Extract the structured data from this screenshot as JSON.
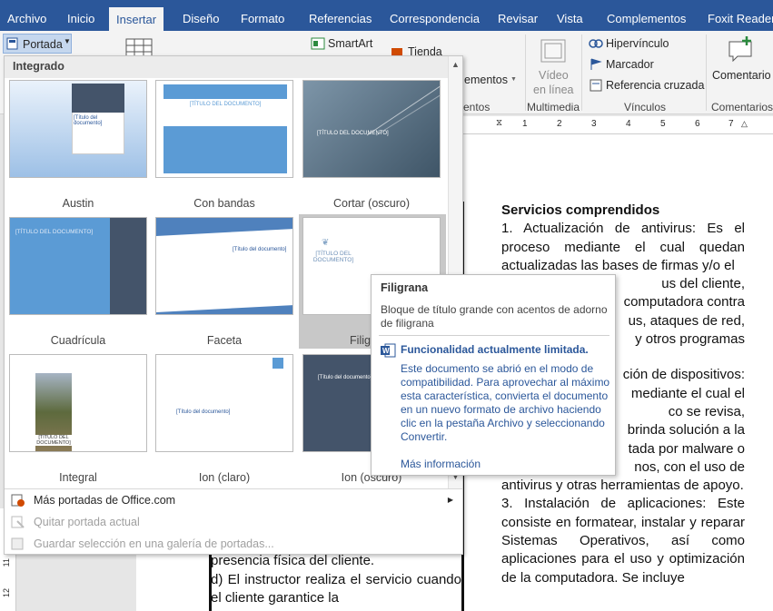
{
  "ribbon_tabs": [
    {
      "label": "Archivo"
    },
    {
      "label": "Inicio"
    },
    {
      "label": "Insertar"
    },
    {
      "label": "Diseño"
    },
    {
      "label": "Formato"
    },
    {
      "label": "Referencias"
    },
    {
      "label": "Correspondencia"
    },
    {
      "label": "Revisar"
    },
    {
      "label": "Vista"
    },
    {
      "label": "Complementos"
    },
    {
      "label": "Foxit Reader P"
    }
  ],
  "ribbon": {
    "portada_label": "Portada",
    "smartart_label": "SmartArt",
    "tienda_label": "Tienda",
    "elementos_label": "ementos",
    "elementos_group": "entos",
    "video_line1": "Vídeo",
    "video_line2": "en línea",
    "multimedia_group": "Multimedia",
    "hipervinculo_label": "Hipervínculo",
    "marcador_label": "Marcador",
    "referencia_label": "Referencia cruzada",
    "vinculos_group": "Vínculos",
    "comentario_label": "Comentario",
    "comentarios_group": "Comentarios"
  },
  "ruler": {
    "ticks": [
      "1",
      "2",
      "3",
      "4",
      "5",
      "6",
      "7"
    ],
    "vertical_ticks": [
      "12",
      "11"
    ]
  },
  "gallery": {
    "header": "Integrado",
    "tiles": [
      {
        "label": "Austin",
        "thumb_title": "[Título del documento]"
      },
      {
        "label": "Con bandas",
        "thumb_title": "[TÍTULO DEL DOCUMENTO]"
      },
      {
        "label": "Cortar (oscuro)",
        "thumb_title": "[TÍTULO DEL DOCUMENTO]"
      },
      {
        "label": "Cuadrícula",
        "thumb_title": "[TÍTULO DEL DOCUMENTO]"
      },
      {
        "label": "Faceta",
        "thumb_title": "[Título del documento]"
      },
      {
        "label": "Filigrana",
        "thumb_title": "[TÍTULO DEL DOCUMENTO]"
      },
      {
        "label": "Integral",
        "thumb_title": "[TÍTULO DEL DOCUMENTO]"
      },
      {
        "label": "Ion (claro)",
        "thumb_title": "[Título del documento]"
      },
      {
        "label": "Ion (oscuro)",
        "thumb_title": "[Título del documento]"
      }
    ],
    "menu": {
      "more": "Más portadas de Office.com",
      "remove": "Quitar portada actual",
      "save": "Guardar selección en una galería de portadas..."
    }
  },
  "tooltip": {
    "title": "Filigrana",
    "description": "Bloque de título grande con acentos de adorno de filigrana",
    "warning_title": "Funcionalidad actualmente limitada.",
    "warning_body": "Este documento se abrió en el modo de compatibilidad. Para aprovechar al máximo esta característica, convierta el documento en un nuevo formato de archivo haciendo clic en la pestaña Archivo y seleccionando Convertir.",
    "link": "Más información"
  },
  "document": {
    "left_column": [
      "presencia física del cliente.",
      "d) El instructor realiza el servicio cuando el cliente garantice la"
    ],
    "right_heading": "Servicios comprendidos",
    "right_paragraphs": [
      "1. Actualización de antivirus: Es el proceso mediante el cual quedan actualizadas las bases de firmas y/o el",
      "us del cliente,",
      "computadora contra",
      "us, ataques de red,",
      "y otros programas",
      "ción de dispositivos:",
      "mediante el cual el",
      "co se revisa,",
      "brinda solución a la",
      "tada por malware o",
      "nos, con el uso de",
      "antivirus y otras herramientas de apoyo.",
      "3. Instalación de aplicaciones: Este consiste en formatear, instalar y reparar Sistemas Operativos, así como aplicaciones para el uso y optimización de la computadora. Se incluye"
    ]
  },
  "colors": {
    "accent": "#2b579a",
    "ribbon_bg": "#f3f3f3",
    "selected_tile_bg": "#c8c8c8"
  }
}
